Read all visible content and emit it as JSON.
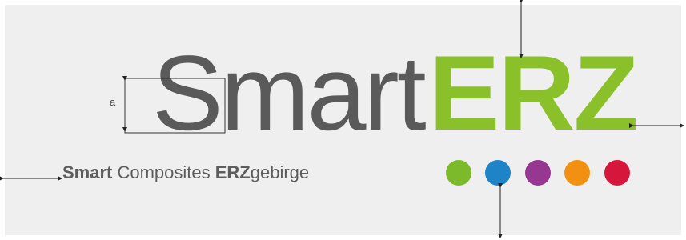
{
  "logo": {
    "wordmark_light": "Smart",
    "wordmark_bold": "ERZ",
    "tagline": [
      {
        "text": "Smart",
        "bold": true
      },
      {
        "text": " Composites ",
        "bold": false
      },
      {
        "text": "ERZ",
        "bold": true
      },
      {
        "text": "gebirge",
        "bold": false
      }
    ]
  },
  "dimension": {
    "label": "a"
  },
  "colors": {
    "background": "#efefef",
    "wordmark_gray": "#5a5a5a",
    "wordmark_green": "#8ac02a",
    "dots": [
      "#7cba2c",
      "#1f83c7",
      "#963792",
      "#f29111",
      "#d7163c"
    ]
  }
}
